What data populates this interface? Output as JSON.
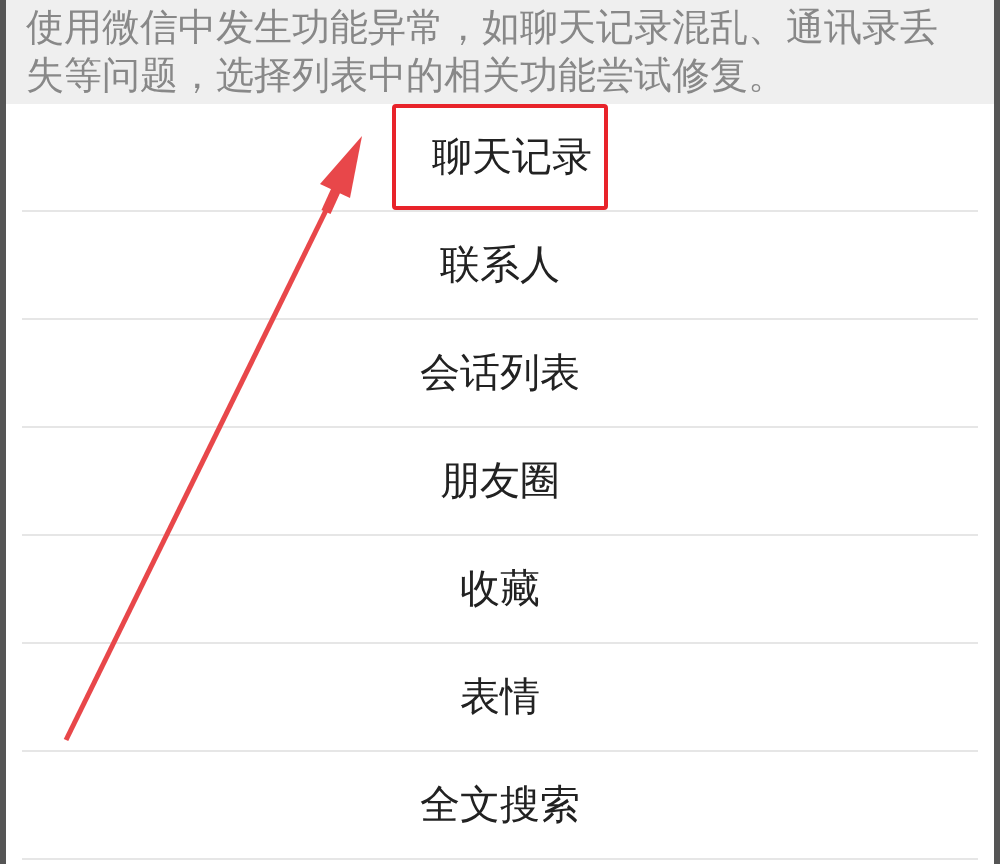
{
  "description": "使用微信中发生功能异常，如聊天记录混乱、通讯录丢失等问题，选择列表中的相关功能尝试修复。",
  "items": [
    {
      "label": "聊天记录",
      "highlighted": true
    },
    {
      "label": "联系人",
      "highlighted": false
    },
    {
      "label": "会话列表",
      "highlighted": false
    },
    {
      "label": "朋友圈",
      "highlighted": false
    },
    {
      "label": "收藏",
      "highlighted": false
    },
    {
      "label": "表情",
      "highlighted": false
    },
    {
      "label": "全文搜索",
      "highlighted": false
    }
  ]
}
